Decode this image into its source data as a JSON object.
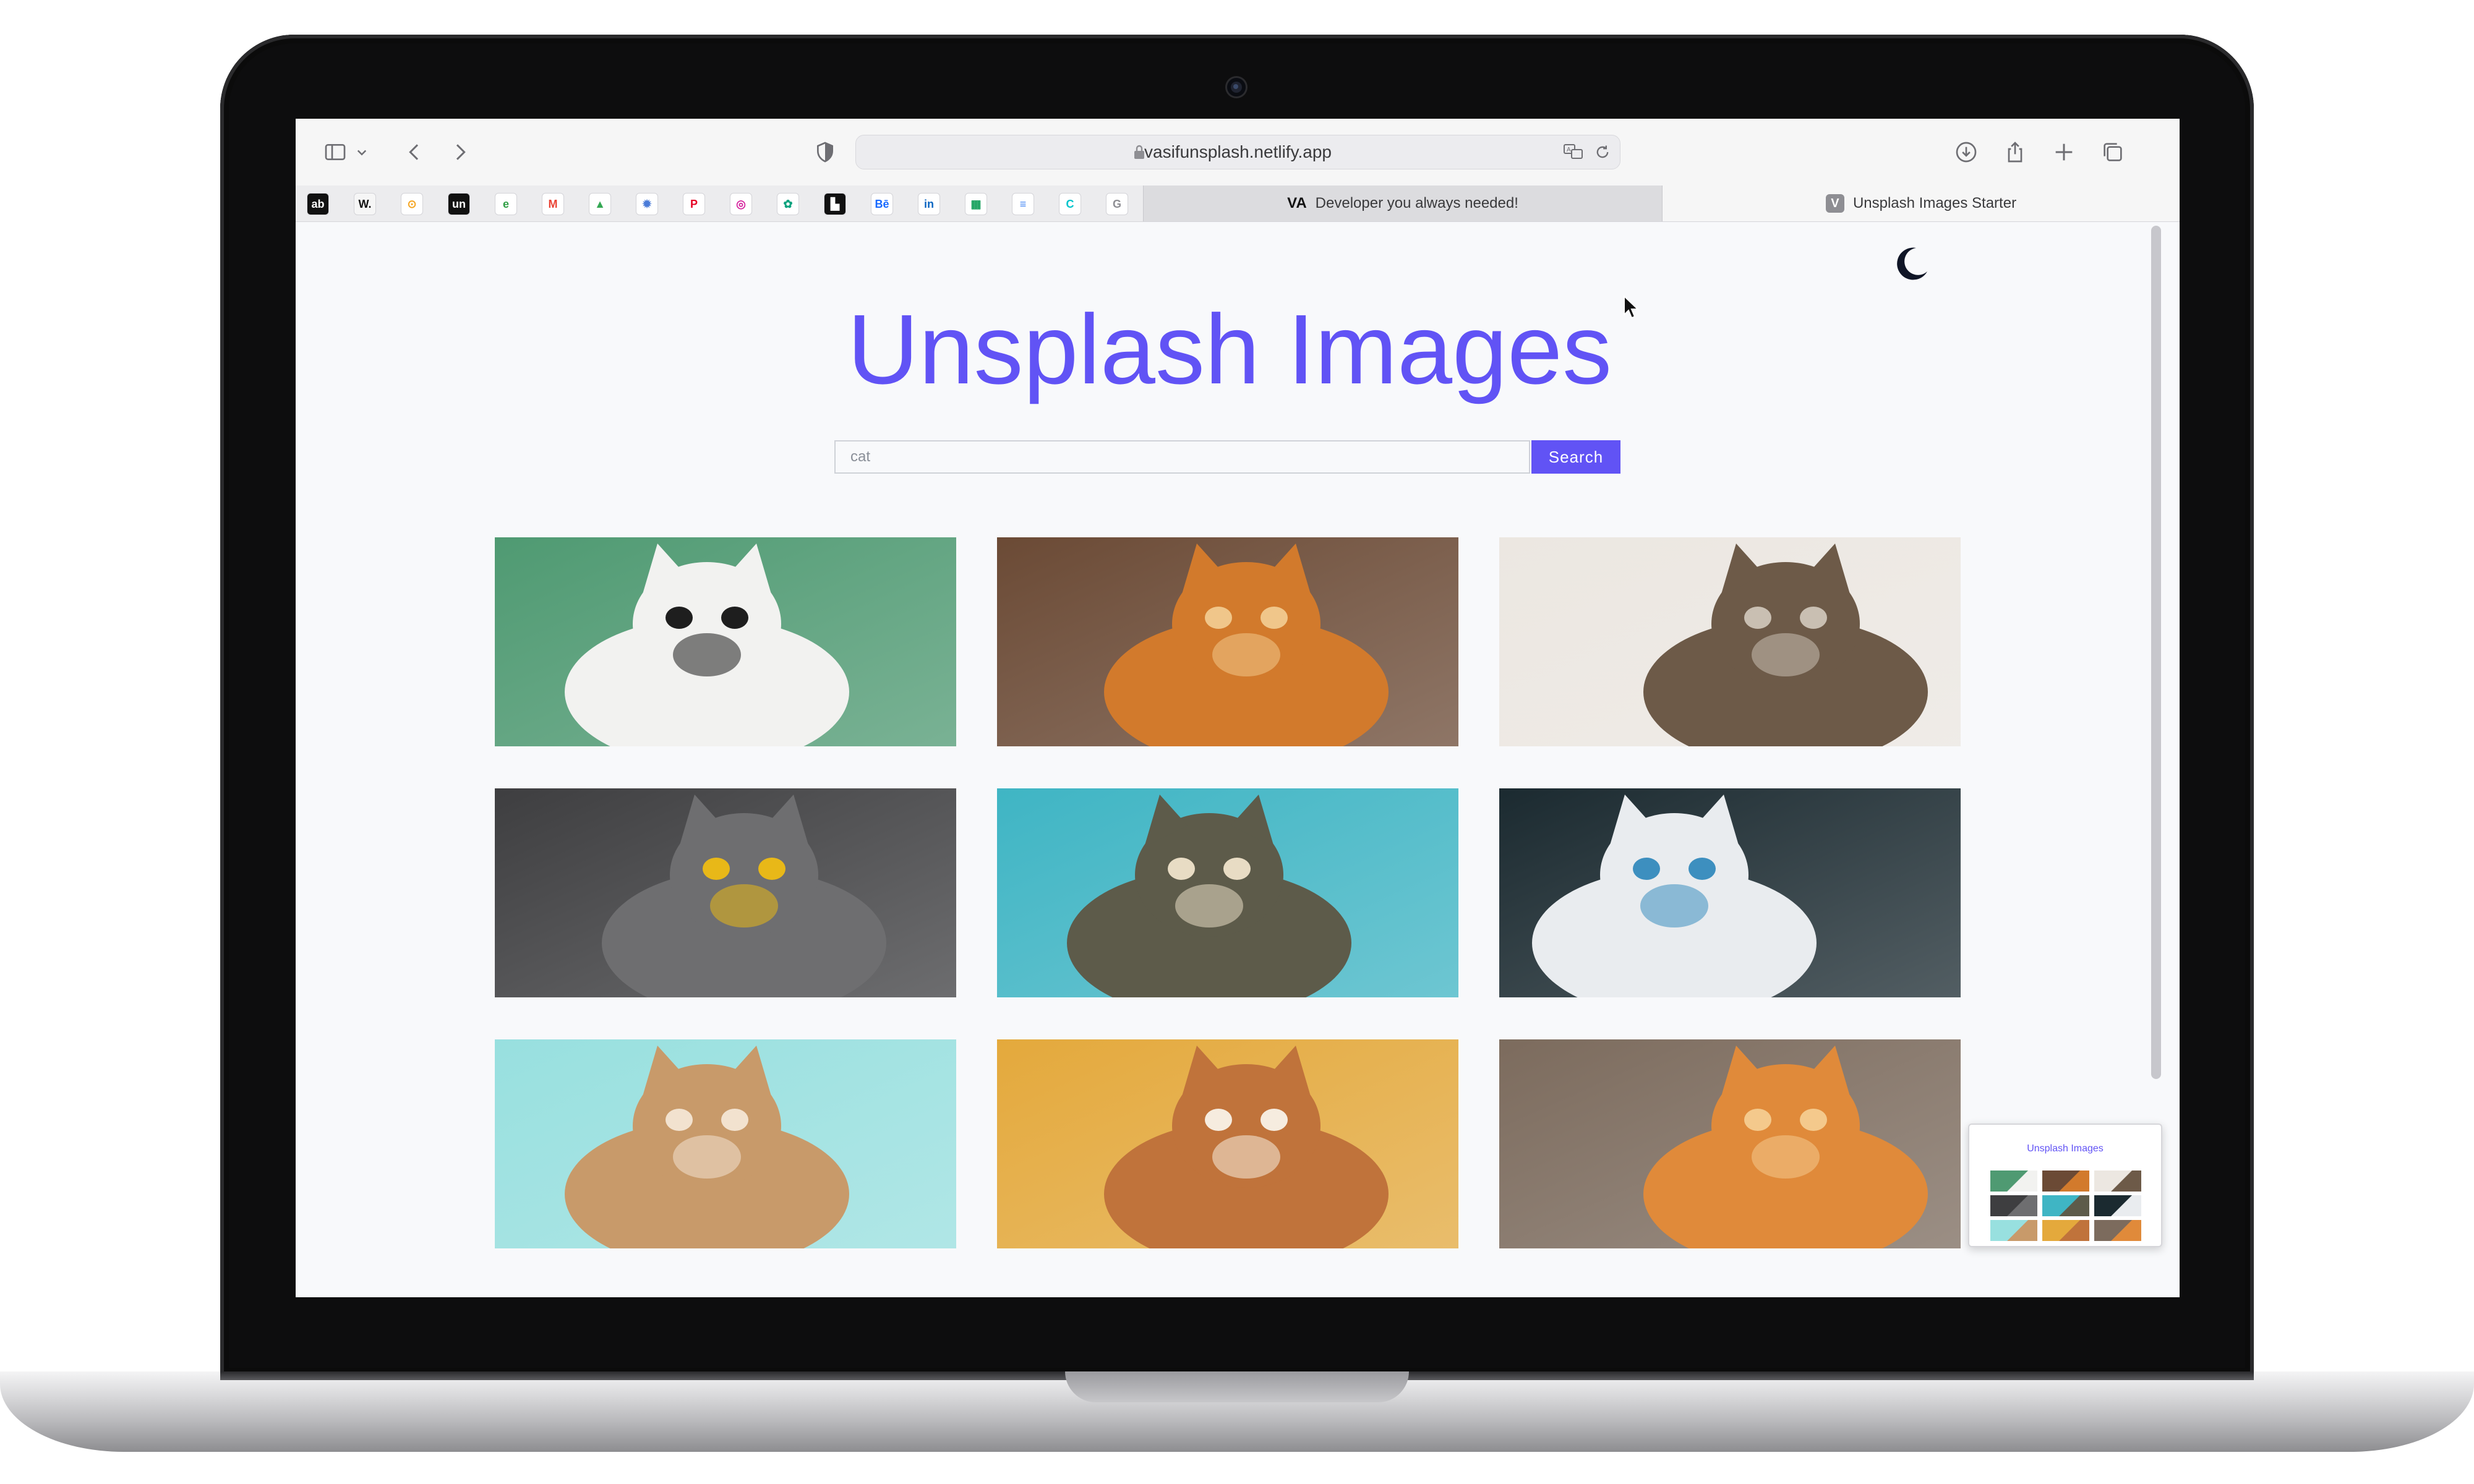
{
  "browser": {
    "url": "vasifunsplash.netlify.app",
    "tabs": [
      {
        "label": "Developer you always needed!",
        "icon": "va-logo-icon",
        "active": false
      },
      {
        "label": "Unsplash Images Starter",
        "icon": "V",
        "active": true
      }
    ],
    "bookmarks": [
      {
        "name": "abdz-icon",
        "glyph": "ab",
        "color": "#111111"
      },
      {
        "name": "webflow-icon",
        "glyph": "W.",
        "color": "#ffffff"
      },
      {
        "name": "coin-icon",
        "glyph": "⊙",
        "color": "#f5a623"
      },
      {
        "name": "unsplash-icon",
        "glyph": "un",
        "color": "#111111"
      },
      {
        "name": "envato-icon",
        "glyph": "e",
        "color": "#2f9e44"
      },
      {
        "name": "gmail-icon",
        "glyph": "M",
        "color": "#ea4335"
      },
      {
        "name": "drive-icon",
        "glyph": "▲",
        "color": "#34a853"
      },
      {
        "name": "bug-icon",
        "glyph": "✹",
        "color": "#4a7bd8"
      },
      {
        "name": "pinterest-icon",
        "glyph": "P",
        "color": "#e60023"
      },
      {
        "name": "instagram-icon",
        "glyph": "◎",
        "color": "#d6249f"
      },
      {
        "name": "openai-icon",
        "glyph": "✿",
        "color": "#10a37f"
      },
      {
        "name": "builder-icon",
        "glyph": "▙",
        "color": "#111111"
      },
      {
        "name": "behance-icon",
        "glyph": "Bē",
        "color": "#1769ff"
      },
      {
        "name": "linkedin-icon",
        "glyph": "in",
        "color": "#0a66c2"
      },
      {
        "name": "sheets-icon",
        "glyph": "▦",
        "color": "#0f9d58"
      },
      {
        "name": "docs-icon",
        "glyph": "≡",
        "color": "#4285f4"
      },
      {
        "name": "canva-icon",
        "glyph": "C",
        "color": "#00c4cc"
      },
      {
        "name": "grammarly-icon",
        "glyph": "G",
        "color": "#8e8e93"
      }
    ]
  },
  "page": {
    "title": "Unsplash Images",
    "search": {
      "value": "cat",
      "button": "Search"
    },
    "accent": "#6153f5",
    "theme_toggle_icon": "moon-icon"
  },
  "thumbnail": {
    "title": "Unsplash Images"
  },
  "images": [
    {
      "name": "cat-green-wall",
      "bg": "#4f9a72",
      "fg": "#f2f2f0",
      "accent": "#1e1e1e"
    },
    {
      "name": "cat-orange-looking-up",
      "bg": "#6b4a35",
      "fg": "#d27a2c",
      "accent": "#f0c68a"
    },
    {
      "name": "cat-tabby-on-steps",
      "bg": "#ece7e1",
      "fg": "#6d5a48",
      "accent": "#c9bfb2"
    },
    {
      "name": "cat-grey-sunglasses",
      "bg": "#3e3e40",
      "fg": "#6e6e70",
      "accent": "#e8b818"
    },
    {
      "name": "cat-peeking-teal-wall",
      "bg": "#3fb5c4",
      "fg": "#5d5b4a",
      "accent": "#e8dcc4"
    },
    {
      "name": "cat-butterfly-nose",
      "bg": "#1b2a30",
      "fg": "#e9ecef",
      "accent": "#3d8fbf"
    },
    {
      "name": "kitten-mint-background",
      "bg": "#98e0df",
      "fg": "#c89a6a",
      "accent": "#f2e2cf"
    },
    {
      "name": "cat-orange-yellow-wall",
      "bg": "#e4a93c",
      "fg": "#c0733b",
      "accent": "#f6ecdf"
    },
    {
      "name": "cat-orange-sleeping-floor",
      "bg": "#7c6b5d",
      "fg": "#e08a3a",
      "accent": "#f4c98c"
    }
  ]
}
